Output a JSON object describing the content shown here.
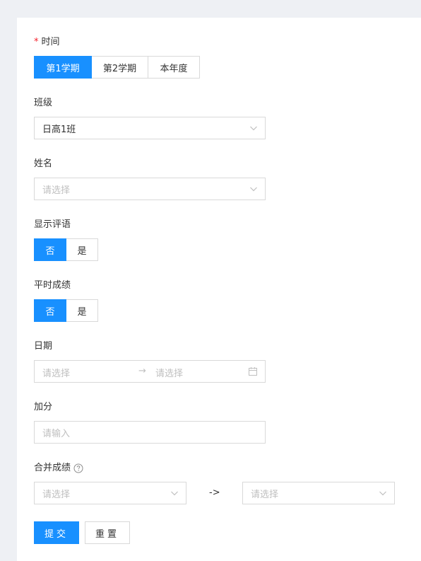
{
  "form": {
    "time": {
      "required_mark": "*",
      "label": "时间",
      "options": [
        "第1学期",
        "第2学期",
        "本年度"
      ],
      "selected_index": 0
    },
    "class": {
      "label": "班级",
      "value": "日高1班"
    },
    "name": {
      "label": "姓名",
      "placeholder": "请选择"
    },
    "show_comment": {
      "label": "显示评语",
      "options": [
        "否",
        "是"
      ],
      "selected_index": 0
    },
    "regular_score": {
      "label": "平时成绩",
      "options": [
        "否",
        "是"
      ],
      "selected_index": 0
    },
    "date": {
      "label": "日期",
      "start_placeholder": "请选择",
      "separator": "→",
      "end_placeholder": "请选择"
    },
    "bonus": {
      "label": "加分",
      "placeholder": "请输入"
    },
    "merge_score": {
      "label": "合并成绩",
      "help_icon": "question-circle-icon",
      "left_placeholder": "请选择",
      "arrow": "->",
      "right_placeholder": "请选择"
    }
  },
  "actions": {
    "submit": "提交",
    "reset": "重置"
  },
  "colors": {
    "primary": "#1890ff",
    "required": "#f5222d",
    "border": "#d9d9d9",
    "placeholder": "#bfbfbf",
    "background": "#eef0f4"
  }
}
